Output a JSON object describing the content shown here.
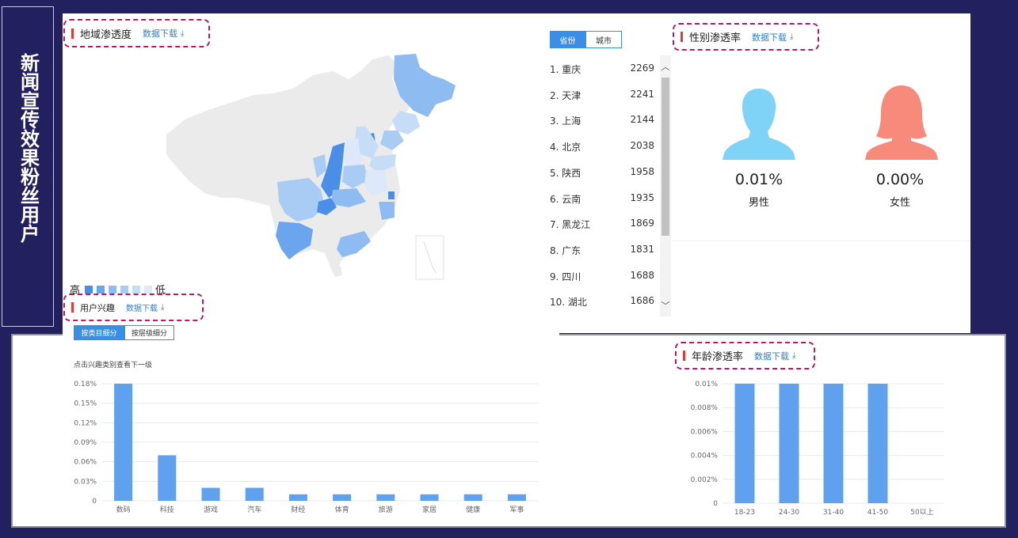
{
  "side_title": "新闻宣传效果粉丝用户",
  "region": {
    "title": "地域渗透度",
    "download": "数据下载",
    "tabs": [
      "省份",
      "城市"
    ],
    "legend_high": "高",
    "legend_low": "低",
    "legend_colors": [
      "#4a8ee8",
      "#6aa5ee",
      "#8dbbf2",
      "#a9ccf5",
      "#c6ddf8",
      "#dde9fa"
    ],
    "ranking": [
      {
        "name": "1. 重庆",
        "value": "2269"
      },
      {
        "name": "2. 天津",
        "value": "2241"
      },
      {
        "name": "3. 上海",
        "value": "2144"
      },
      {
        "name": "4. 北京",
        "value": "2038"
      },
      {
        "name": "5. 陕西",
        "value": "1958"
      },
      {
        "name": "6. 云南",
        "value": "1935"
      },
      {
        "name": "7. 黑龙江",
        "value": "1869"
      },
      {
        "name": "8. 广东",
        "value": "1831"
      },
      {
        "name": "9. 四川",
        "value": "1688"
      },
      {
        "name": "10. 湖北",
        "value": "1686"
      }
    ]
  },
  "gender": {
    "title": "性别渗透率",
    "download": "数据下载",
    "male_pct": "0.01%",
    "male_label": "男性",
    "female_pct": "0.00%",
    "female_label": "女性",
    "male_color": "#7fd3f7",
    "female_color": "#f88a7c"
  },
  "interest": {
    "title": "用户兴趣",
    "download": "数据下载",
    "tabs": [
      "按类目细分",
      "按层级细分"
    ],
    "hint": "点击兴趣类别查看下一级"
  },
  "age": {
    "title": "年龄渗透率",
    "download": "数据下载"
  },
  "chart_data": [
    {
      "type": "bar",
      "categories": [
        "数码",
        "科技",
        "游戏",
        "汽车",
        "财经",
        "体育",
        "旅游",
        "家居",
        "健康",
        "军事"
      ],
      "values": [
        0.18,
        0.07,
        0.02,
        0.02,
        0.01,
        0.01,
        0.01,
        0.01,
        0.01,
        0.01
      ],
      "yticks": [
        "0",
        "0.03%",
        "0.06%",
        "0.09%",
        "0.12%",
        "0.15%",
        "0.18%"
      ],
      "ylim": [
        0,
        0.18
      ],
      "color": "#5fa1ef",
      "grid": true
    },
    {
      "type": "bar",
      "categories": [
        "18-23",
        "24-30",
        "31-40",
        "41-50",
        "50以上"
      ],
      "values": [
        0.01,
        0.01,
        0.01,
        0.01,
        0
      ],
      "yticks": [
        "0",
        "0.002%",
        "0.004%",
        "0.006%",
        "0.008%",
        "0.01%"
      ],
      "ylim": [
        0,
        0.01
      ],
      "color": "#5fa1ef",
      "grid": true
    }
  ]
}
